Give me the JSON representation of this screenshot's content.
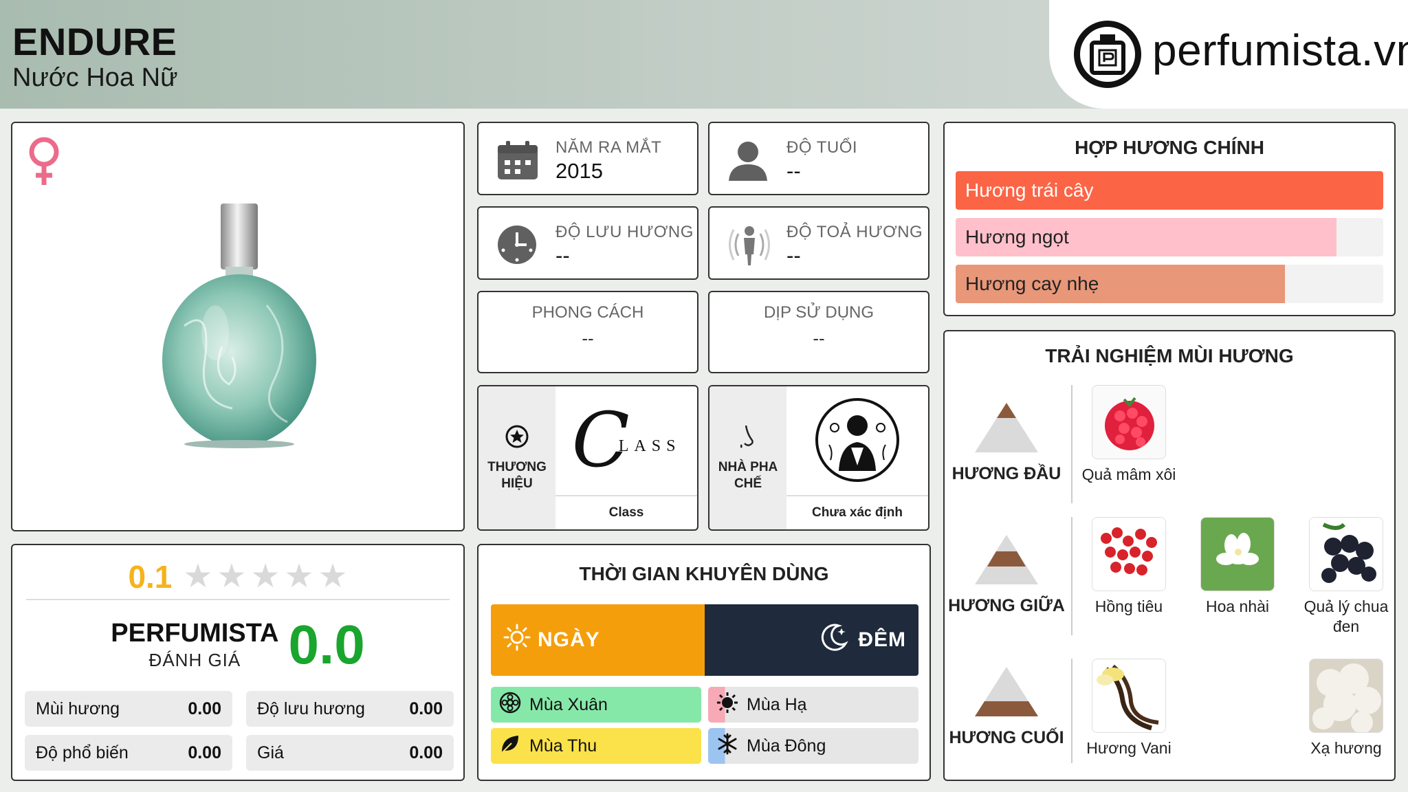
{
  "header": {
    "title": "ENDURE",
    "subtitle": "Nước Hoa Nữ",
    "logo_text": "perfumista.vn"
  },
  "product": {
    "gender_icon": "female-symbol-icon",
    "image": "perfume-bottle"
  },
  "rating": {
    "user_score": "0.1",
    "stars_filled": 0,
    "stars_total": 5,
    "perf_label_1": "PERFUMISTA",
    "perf_label_2": "ĐÁNH GIÁ",
    "perf_score": "0.0",
    "metrics": [
      {
        "label": "Mùi hương",
        "value": "0.00"
      },
      {
        "label": "Độ lưu hương",
        "value": "0.00"
      },
      {
        "label": "Độ phổ biến",
        "value": "0.00"
      },
      {
        "label": "Giá",
        "value": "0.00"
      }
    ]
  },
  "info": {
    "launch": {
      "label": "NĂM RA MẮT",
      "value": "2015",
      "icon": "calendar-icon"
    },
    "age": {
      "label": "ĐỘ TUỔI",
      "value": "--",
      "icon": "person-icon"
    },
    "longevity": {
      "label": "ĐỘ LƯU HƯƠNG",
      "value": "--",
      "icon": "clock-icon"
    },
    "sillage": {
      "label": "ĐỘ TOẢ HƯƠNG",
      "value": "--",
      "icon": "sillage-icon"
    },
    "style": {
      "label": "PHONG CÁCH",
      "value": "--"
    },
    "occasion": {
      "label": "DỊP SỬ DỤNG",
      "value": "--"
    }
  },
  "brand": {
    "label_1": "THƯƠNG",
    "label_2": "HIỆU",
    "name": "Class",
    "logo_text": "LASS",
    "logo_initial": "C"
  },
  "perfumer": {
    "label_1": "NHÀ PHA",
    "label_2": "CHẾ",
    "name": "Chưa xác định"
  },
  "time": {
    "title": "THỜI GIAN KHUYÊN DÙNG",
    "day_label": "NGÀY",
    "night_label": "ĐÊM",
    "day_ratio": 0.5,
    "seasons": [
      {
        "label": "Mùa Xuân",
        "icon": "flower-icon",
        "color": "#86e8a8",
        "level": 1.0
      },
      {
        "label": "Mùa Hạ",
        "icon": "sun-icon",
        "color": "#f7a9b6",
        "level": 0.08
      },
      {
        "label": "Mùa Thu",
        "icon": "leaf-icon",
        "color": "#fbe14a",
        "level": 1.0
      },
      {
        "label": "Mùa Đông",
        "icon": "snowflake-icon",
        "color": "#9cc4f0",
        "level": 0.08
      }
    ]
  },
  "accords": {
    "title": "HỢP HƯƠNG CHÍNH",
    "items": [
      {
        "label": "Hương trái cây",
        "level": 1.0,
        "color": "#fc6446",
        "text_color": "#ffffff"
      },
      {
        "label": "Hương ngọt",
        "level": 0.89,
        "color": "#ffc0cb",
        "text_color": "#222222"
      },
      {
        "label": "Hương cay nhẹ",
        "level": 0.77,
        "color": "#e89779",
        "text_color": "#222222"
      }
    ]
  },
  "notes": {
    "title": "TRẢI NGHIỆM MÙI HƯƠNG",
    "top_label": "HƯƠNG ĐẦU",
    "middle_label": "HƯƠNG GIỮA",
    "base_label": "HƯƠNG CUỐI",
    "top": [
      {
        "name": "Quả mâm xôi"
      }
    ],
    "middle": [
      {
        "name": "Hồng tiêu"
      },
      {
        "name": "Hoa nhài"
      },
      {
        "name": "Quả lý chua đen"
      }
    ],
    "base": [
      {
        "name": "Hương Vani"
      },
      {
        "name": "Xạ hương"
      }
    ]
  }
}
